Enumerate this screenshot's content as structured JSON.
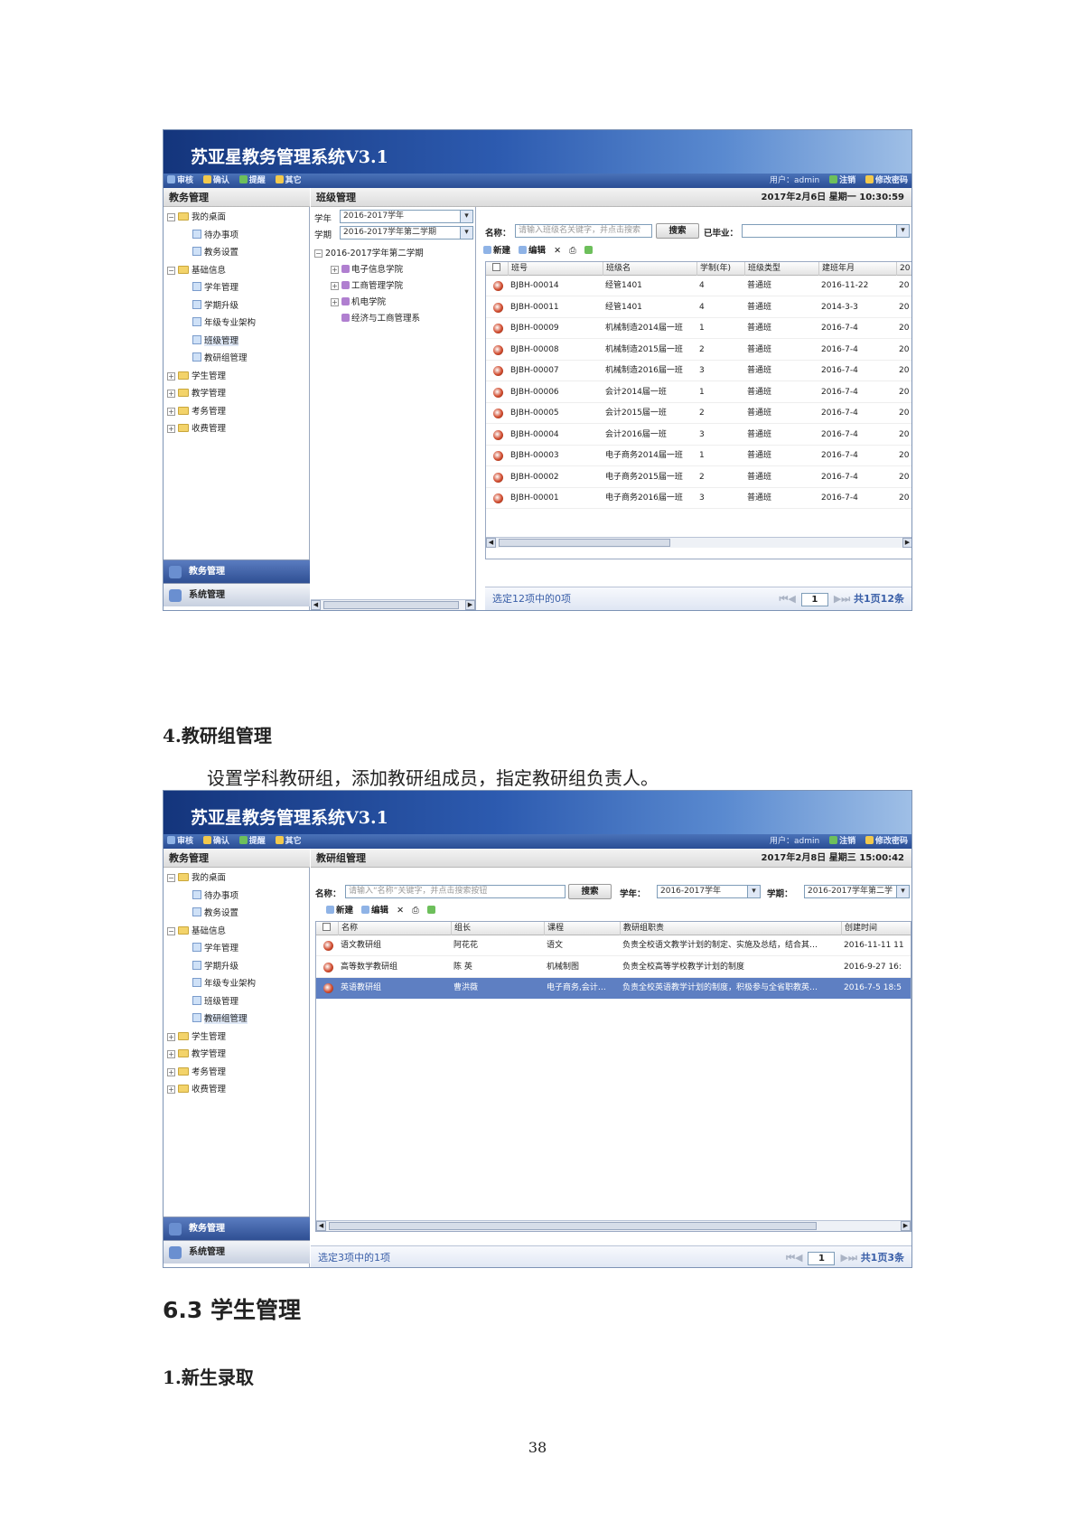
{
  "app": {
    "title": "苏亚星教务管理系统V3.1",
    "menu": [
      "审核",
      "确认",
      "提醒",
      "其它"
    ],
    "user_label": "用户：admin",
    "logout": "注销",
    "change_pwd": "修改密码",
    "left_header": "教务管理",
    "tree": [
      {
        "label": "我的桌面",
        "level": 0,
        "type": "folder",
        "expander": "⊟"
      },
      {
        "label": "待办事项",
        "level": 1,
        "type": "leaf"
      },
      {
        "label": "教务设置",
        "level": 1,
        "type": "leaf"
      },
      {
        "label": "基础信息",
        "level": 0,
        "type": "folder",
        "expander": "⊟"
      },
      {
        "label": "学年管理",
        "level": 1,
        "type": "leaf"
      },
      {
        "label": "学期升级",
        "level": 1,
        "type": "leaf"
      },
      {
        "label": "年级专业架构",
        "level": 1,
        "type": "leaf"
      },
      {
        "label": "班级管理",
        "level": 1,
        "type": "leaf"
      },
      {
        "label": "教研组管理",
        "level": 1,
        "type": "leaf"
      },
      {
        "label": "学生管理",
        "level": 0,
        "type": "folder",
        "expander": "⊞"
      },
      {
        "label": "教学管理",
        "level": 0,
        "type": "folder",
        "expander": "⊞"
      },
      {
        "label": "考务管理",
        "level": 0,
        "type": "folder",
        "expander": "⊞"
      },
      {
        "label": "收费管理",
        "level": 0,
        "type": "folder",
        "expander": "⊞"
      }
    ],
    "bottom_tabs": [
      "教务管理",
      "系统管理"
    ]
  },
  "shot1": {
    "header": "班级管理",
    "datetime": "2017年2月6日  星期一  10:30:59",
    "year_label": "学年",
    "year_value": "2016-2017学年",
    "term_label": "学期",
    "term_value": "2016-2017学年第二学期",
    "tree_root": "2016-2017学年第二学期",
    "tree_items": [
      "电子信息学院",
      "工商管理学院",
      "机电学院",
      "经济与工商管理系"
    ],
    "name_label": "名称：",
    "name_placeholder": "请输入班级名关键字，并点击搜索",
    "search_btn": "搜索",
    "graduated_label": "已毕业：",
    "tool_new": "新建",
    "tool_edit": "编辑",
    "columns": [
      "班号",
      "班级名",
      "学制(年)",
      "班级类型",
      "建班年月",
      "20"
    ],
    "rows": [
      [
        "BJBH-00014",
        "经管1401",
        "4",
        "普通班",
        "2016-11-22",
        "20"
      ],
      [
        "BJBH-00011",
        "经管1401",
        "4",
        "普通班",
        "2014-3-3",
        "20"
      ],
      [
        "BJBH-00009",
        "机械制造2014届一班",
        "1",
        "普通班",
        "2016-7-4",
        "20"
      ],
      [
        "BJBH-00008",
        "机械制造2015届一班",
        "2",
        "普通班",
        "2016-7-4",
        "20"
      ],
      [
        "BJBH-00007",
        "机械制造2016届一班",
        "3",
        "普通班",
        "2016-7-4",
        "20"
      ],
      [
        "BJBH-00006",
        "会计2014届一班",
        "1",
        "普通班",
        "2016-7-4",
        "20"
      ],
      [
        "BJBH-00005",
        "会计2015届一班",
        "2",
        "普通班",
        "2016-7-4",
        "20"
      ],
      [
        "BJBH-00004",
        "会计2016届一班",
        "3",
        "普通班",
        "2016-7-4",
        "20"
      ],
      [
        "BJBH-00003",
        "电子商务2014届一班",
        "1",
        "普通班",
        "2016-7-4",
        "20"
      ],
      [
        "BJBH-00002",
        "电子商务2015届一班",
        "2",
        "普通班",
        "2016-7-4",
        "20"
      ],
      [
        "BJBH-00001",
        "电子商务2016届一班",
        "3",
        "普通班",
        "2016-7-4",
        "20"
      ]
    ],
    "pager_info": "选定12项中的0项",
    "pager_page": "1",
    "pager_total": "共1页12条"
  },
  "doc": {
    "section4_heading": "4.教研组管理",
    "section4_text": "设置学科教研组，添加教研组成员，指定教研组负责人。",
    "section63_heading": "6.3 学生管理",
    "sub1_heading": "1.新生录取",
    "page_number": "38"
  },
  "shot2": {
    "header": "教研组管理",
    "datetime": "2017年2月8日  星期三  15:00:42",
    "name_label": "名称：",
    "name_placeholder": "请输入“名称”关键字，并点击搜索按钮",
    "search_btn": "搜索",
    "year_label": "学年：",
    "year_value": "2016-2017学年",
    "term_label": "学期：",
    "term_value": "2016-2017学年第二学",
    "tool_new": "新建",
    "tool_edit": "编辑",
    "columns": [
      "名称",
      "组长",
      "课程",
      "教研组职责",
      "创建时间"
    ],
    "rows": [
      [
        "语文教研组",
        "阿花花",
        "语文",
        "负责全校语文教学计划的制定、实施及总结，结合其…",
        "2016-11-11 11"
      ],
      [
        "高等数学教研组",
        "陈 英",
        "机械制图",
        "负责全校高等学校教学计划的制度",
        "2016-9-27 16:"
      ],
      [
        "英语教研组",
        "曹洪薇",
        "电子商务,会计…",
        "负责全校英语教学计划的制度，积极参与全省职教英…",
        "2016-7-5 18:5"
      ]
    ],
    "pager_info": "选定3项中的1项",
    "pager_page": "1",
    "pager_total": "共1页3条"
  }
}
